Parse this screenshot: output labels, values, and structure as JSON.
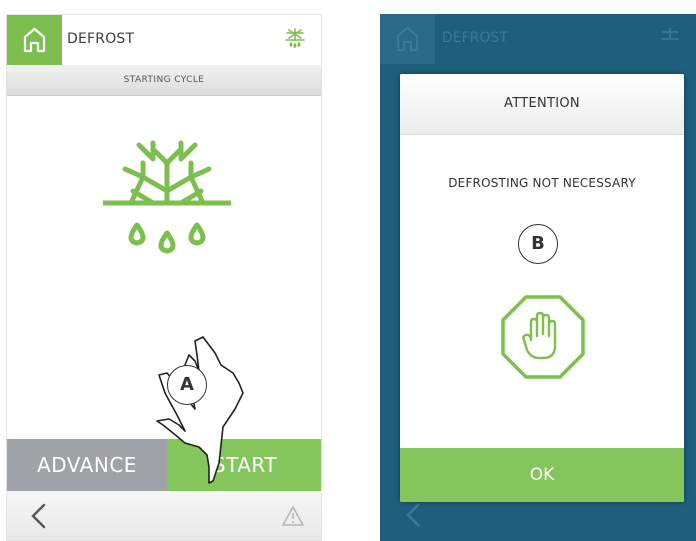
{
  "left_screen": {
    "header": {
      "title": "DEFROST",
      "home_icon": "home-icon",
      "mode_icon": "defrost-icon"
    },
    "status": "STARTING CYCLE",
    "main_icon": "defrost-snowflake-icon",
    "buttons": {
      "advance": "ADVANCE",
      "start": "START"
    },
    "footer": {
      "back_icon": "back-chevron-icon",
      "warning_icon": "warning-icon"
    },
    "callout": "A"
  },
  "right_screen": {
    "header": {
      "title": "DEFROST"
    },
    "dialog": {
      "title": "ATTENTION",
      "message": "DEFROSTING NOT NECESSARY",
      "icon": "stop-hand-icon",
      "ok": "OK"
    },
    "callout": "B"
  },
  "colors": {
    "accent": "#7dbf4f",
    "button_gray": "#9fa3a7",
    "overlay": "#1f5f7d"
  }
}
